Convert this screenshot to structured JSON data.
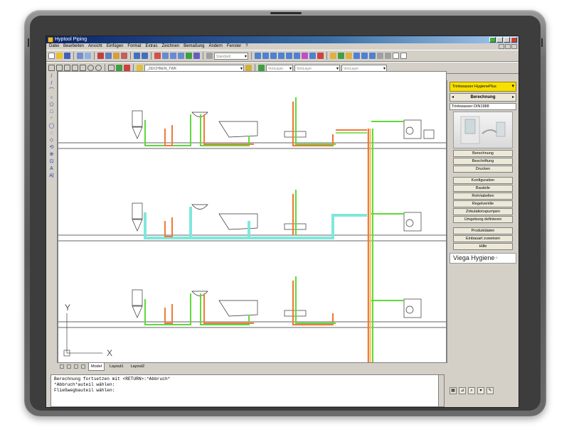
{
  "window": {
    "title": "Hyptool Piping"
  },
  "menu": [
    "Datei",
    "Bearbeiten",
    "Ansicht",
    "Einfügen",
    "Format",
    "Extras",
    "Zeichnen",
    "Bemaßung",
    "Ändern",
    "Fenster",
    "?"
  ],
  "toolbar": {
    "style_combo": "Standard",
    "layer_combo": "_ZEICHNEN_TWK",
    "linetype_combo": "VonLayer",
    "lineweight_combo": "VonLayer",
    "color_combo": "VonLayer",
    "plot_combo": "VonLayer"
  },
  "left_tools": [
    "/",
    "/",
    "⌒",
    "○",
    "⬠",
    "□",
    "◜",
    "◯",
    "◌",
    "◇",
    "⟲",
    "⊕",
    "⊡",
    "A",
    "A|"
  ],
  "drawing": {
    "axis_y": "Y",
    "axis_x": "X",
    "colors": {
      "cold": "#5fd93a",
      "hot": "#f07a3a",
      "highlight": "#7fe7dc",
      "riser_yellow": "#e8c040"
    }
  },
  "tabs": {
    "model": "Model",
    "layout1": "Layout1",
    "layout2": "Layout2"
  },
  "command_line": [
    "Berechnung fortsetzen mit <RETURN>:*Abbruch*",
    "*Abbruch*auteil wählen:",
    "Fließwegbauteil wählen:"
  ],
  "panel": {
    "dropdown": "Trinkwasser HygienePlus",
    "section": "Berechnung",
    "norm": "Trinkwasser DIN1988",
    "buttons_group1": [
      "Berechnung",
      "Beschriftung",
      "Drucken"
    ],
    "buttons_group2": [
      "Konfiguration",
      "Bauteile",
      "Rohrtabellen",
      "Regelventile",
      "Zirkulationspumpen",
      "Umgebung definieren"
    ],
    "buttons_group3": [
      "Produktdaten",
      "Einbauart zuweisen",
      "Hilfe"
    ],
    "brand": "Viega Hygiene",
    "brand_plus": "+"
  }
}
